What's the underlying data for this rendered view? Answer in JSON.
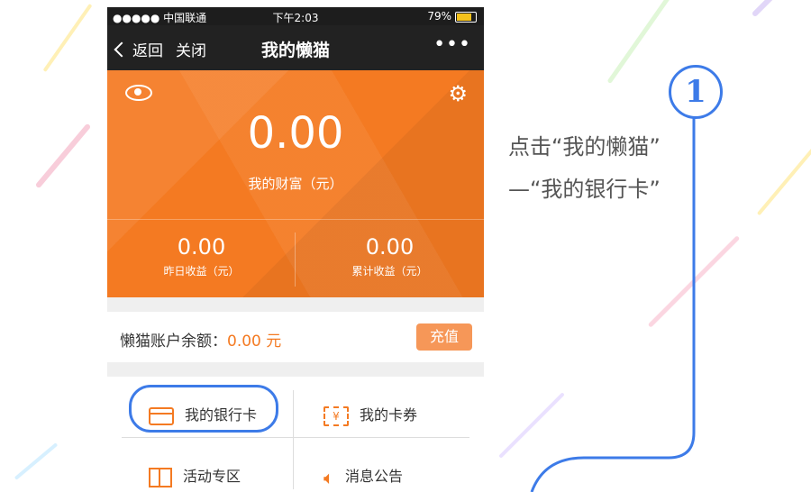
{
  "status_bar": {
    "signal": "●●●●● 中国联通",
    "time": "下午2:03",
    "battery": "79%"
  },
  "nav": {
    "back": "返回",
    "close": "关闭",
    "title": "我的懒猫",
    "more": "•••"
  },
  "wealth": {
    "value": "0.00",
    "label": "我的财富（元）"
  },
  "stats": [
    {
      "value": "0.00",
      "label": "昨日收益（元）"
    },
    {
      "value": "0.00",
      "label": "累计收益（元）"
    }
  ],
  "balance": {
    "label": "懒猫账户余额：",
    "amount": "0.00 元",
    "charge": "充值"
  },
  "menu": [
    {
      "label": "我的银行卡",
      "icon": "bank-card-icon"
    },
    {
      "label": "我的卡券",
      "icon": "coupon-icon",
      "icon_glyph": "¥"
    },
    {
      "label": "活动专区",
      "icon": "gift-icon"
    },
    {
      "label": "消息公告",
      "icon": "speaker-icon"
    }
  ],
  "hint": {
    "line1": "点击“我的懒猫”",
    "line2": "—“我的银行卡”"
  },
  "step_number": "1",
  "colors": {
    "accent": "#f47a22",
    "guide": "#3d7be8"
  }
}
